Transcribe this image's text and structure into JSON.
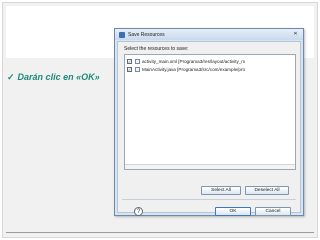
{
  "slide": {
    "bullet_check": "✓",
    "bullet_text": "Darán  clic en «OK»"
  },
  "dialog": {
    "title": "Save Resources",
    "close_symbol": "✕",
    "prompt": "Select the resources to save:",
    "resources": [
      {
        "checked": true,
        "check_glyph": "✓",
        "label": "activity_main.xml  [Programa3/res/layout/activity_m"
      },
      {
        "checked": true,
        "check_glyph": "✓",
        "label": "MainActivity.java  [Programa3/src/com/example/pro"
      }
    ],
    "buttons": {
      "select_all": "Select All",
      "deselect_all": "Deselect All",
      "ok": "OK",
      "cancel": "Cancel"
    },
    "help_symbol": "?"
  },
  "colors": {
    "accent_text": "#1b8a7a",
    "dialog_frame": "#d7e4f2"
  }
}
